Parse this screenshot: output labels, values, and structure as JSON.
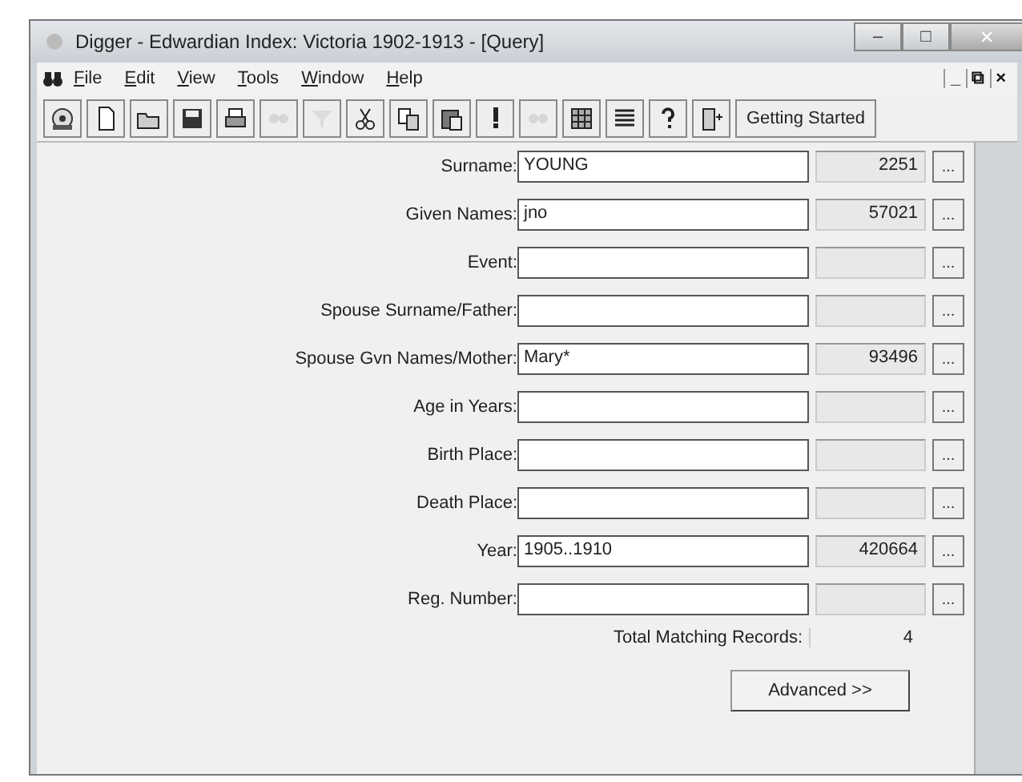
{
  "window": {
    "title": "Digger - Edwardian Index: Victoria 1902-1913 - [Query]",
    "controls": [
      "–",
      "□",
      "✕"
    ]
  },
  "menu": {
    "items": [
      "File",
      "Edit",
      "View",
      "Tools",
      "Window",
      "Help"
    ],
    "mdi_controls": [
      "_",
      "⧉",
      "×"
    ]
  },
  "toolbar": [
    {
      "kind": "disc",
      "disabled": false
    },
    {
      "kind": "new",
      "disabled": false
    },
    {
      "kind": "open",
      "disabled": false
    },
    {
      "kind": "save",
      "disabled": false
    },
    {
      "kind": "print",
      "disabled": false
    },
    {
      "kind": "find",
      "disabled": true
    },
    {
      "kind": "filter",
      "disabled": true
    },
    {
      "kind": "cut",
      "disabled": false
    },
    {
      "kind": "copy",
      "disabled": false
    },
    {
      "kind": "paste",
      "disabled": false
    },
    {
      "kind": "run",
      "disabled": false
    },
    {
      "kind": "find",
      "disabled": true
    },
    {
      "kind": "grid",
      "disabled": false
    },
    {
      "kind": "list",
      "disabled": false
    },
    {
      "kind": "help",
      "disabled": false
    },
    {
      "kind": "exit",
      "disabled": false
    },
    {
      "kind": "text",
      "label": "Getting Started",
      "disabled": false
    }
  ],
  "fields": [
    {
      "label": "Surname:",
      "value": "YOUNG",
      "count": "2251"
    },
    {
      "label": "Given Names:",
      "value": "jno",
      "count": "57021"
    },
    {
      "label": "Event:"
    },
    {
      "label": "Spouse Surname/Father:"
    },
    {
      "label": "Spouse Gvn Names/Mother:",
      "value": "Mary*",
      "count": "93496"
    },
    {
      "label": "Age in Years:"
    },
    {
      "label": "Birth Place:"
    },
    {
      "label": "Death Place:"
    },
    {
      "label": "Year:",
      "value": "1905..1910",
      "count": "420664"
    },
    {
      "label": "Reg. Number:"
    }
  ],
  "field_button": "...",
  "total": {
    "label": "Total Matching Records:",
    "value": "4"
  },
  "advanced_button": "Advanced >>"
}
